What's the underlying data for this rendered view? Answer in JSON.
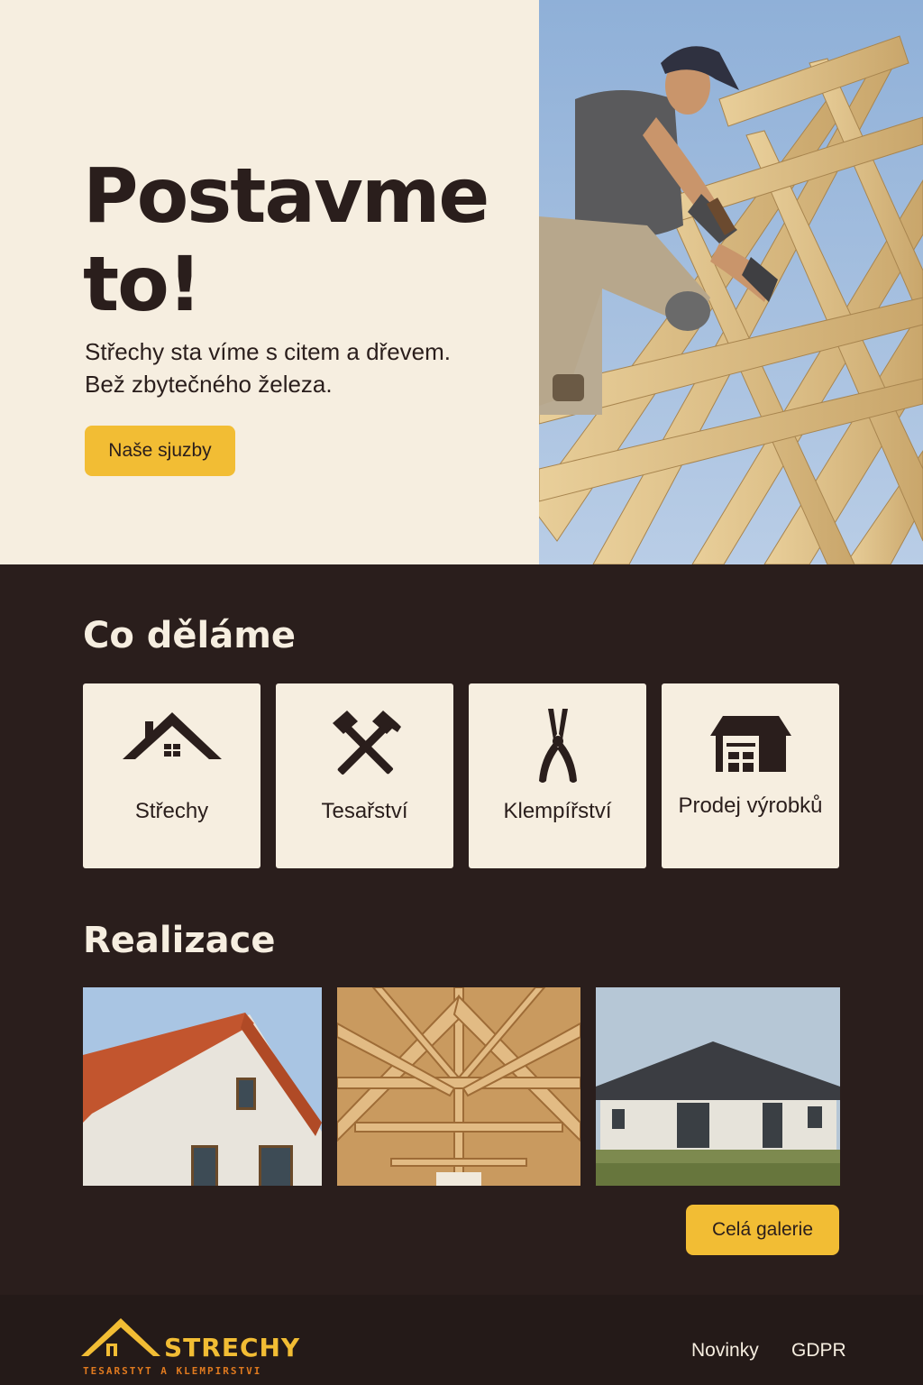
{
  "hero": {
    "title": "Postavme to!",
    "subtitle_line1": "Střechy sta víme s citem a dřevem.",
    "subtitle_line2": "Bež zbytečného železa.",
    "cta_label": "Naše sjuzby"
  },
  "services": {
    "title": "Co děláme",
    "items": [
      {
        "label": "Střechy",
        "icon": "house-roof-icon"
      },
      {
        "label": "Tesařství",
        "icon": "hammers-icon"
      },
      {
        "label": "Klempířství",
        "icon": "pliers-icon"
      },
      {
        "label": "Prodej výrobků",
        "icon": "warehouse-icon"
      }
    ]
  },
  "gallery": {
    "title": "Realizace",
    "button_label": "Celá galerie"
  },
  "footer": {
    "logo_word": "STRECHY",
    "logo_tagline": "TESARSTYT A KLEMPIRSTVI",
    "links": [
      "Novinky",
      "GDPR"
    ]
  },
  "colors": {
    "accent": "#f2bd34",
    "dark": "#2a1e1c",
    "cream": "#f6eee0",
    "logo_orange": "#e07a1f"
  }
}
